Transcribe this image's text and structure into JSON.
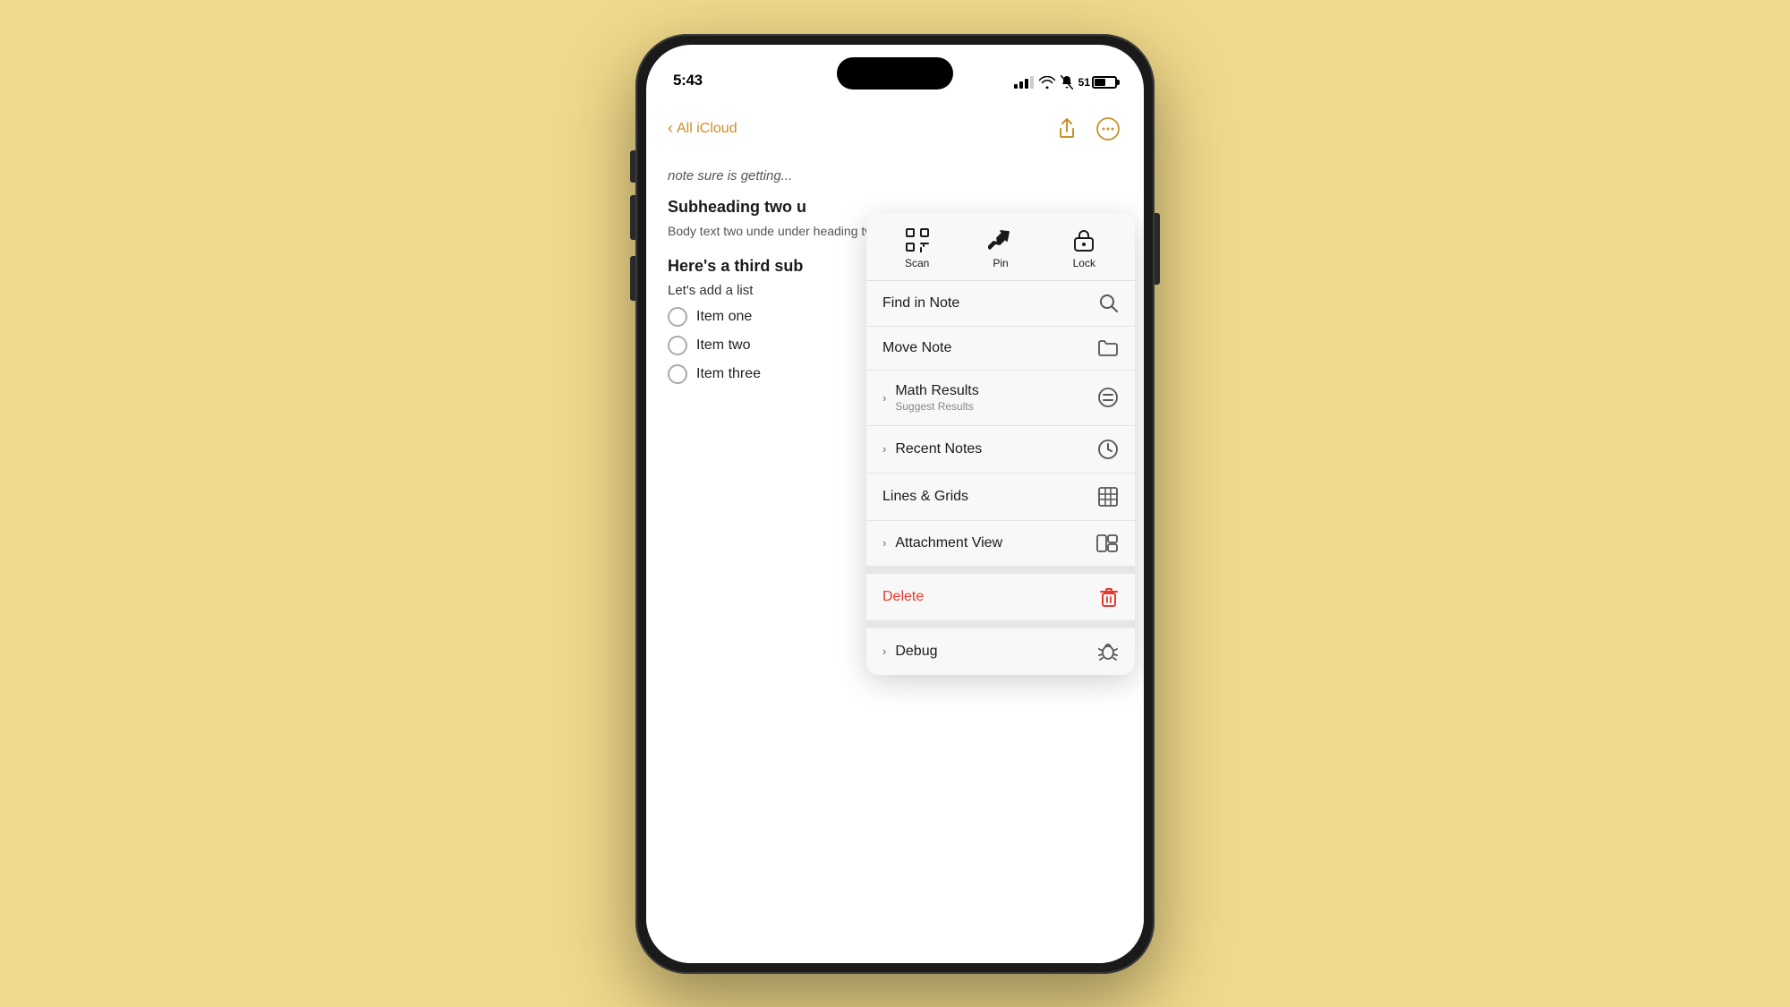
{
  "background_color": "#f0d98a",
  "phone": {
    "status_bar": {
      "time": "5:43",
      "battery_percent": "51"
    },
    "nav": {
      "back_label": "All iCloud"
    },
    "note": {
      "fade_text": "note sure is getting...",
      "subheading1": "Subheading two u",
      "body1": "Body text two unde\nunder heading two",
      "subheading2": "Here's a third sub",
      "list_intro": "Let's add a list",
      "checklist": [
        {
          "label": "Item one"
        },
        {
          "label": "Item two"
        },
        {
          "label": "Item three"
        }
      ]
    },
    "dropdown": {
      "icon_row": [
        {
          "symbol": "scan",
          "label": "Scan"
        },
        {
          "symbol": "pin",
          "label": "Pin"
        },
        {
          "symbol": "lock",
          "label": "Lock"
        }
      ],
      "menu_items": [
        {
          "id": "find-in-note",
          "label": "Find in Note",
          "has_chevron": false,
          "icon": "search"
        },
        {
          "id": "move-note",
          "label": "Move Note",
          "has_chevron": false,
          "icon": "folder"
        },
        {
          "id": "math-results",
          "label": "Math Results",
          "sublabel": "Suggest Results",
          "has_chevron": true,
          "icon": "equal-circle"
        },
        {
          "id": "recent-notes",
          "label": "Recent Notes",
          "has_chevron": true,
          "icon": "clock"
        },
        {
          "id": "lines-grids",
          "label": "Lines & Grids",
          "has_chevron": false,
          "icon": "grid"
        },
        {
          "id": "attachment-view",
          "label": "Attachment View",
          "has_chevron": true,
          "icon": "layout"
        },
        {
          "id": "delete",
          "label": "Delete",
          "has_chevron": false,
          "icon": "trash",
          "destructive": true
        },
        {
          "id": "debug",
          "label": "Debug",
          "has_chevron": true,
          "icon": "bug"
        }
      ]
    }
  }
}
